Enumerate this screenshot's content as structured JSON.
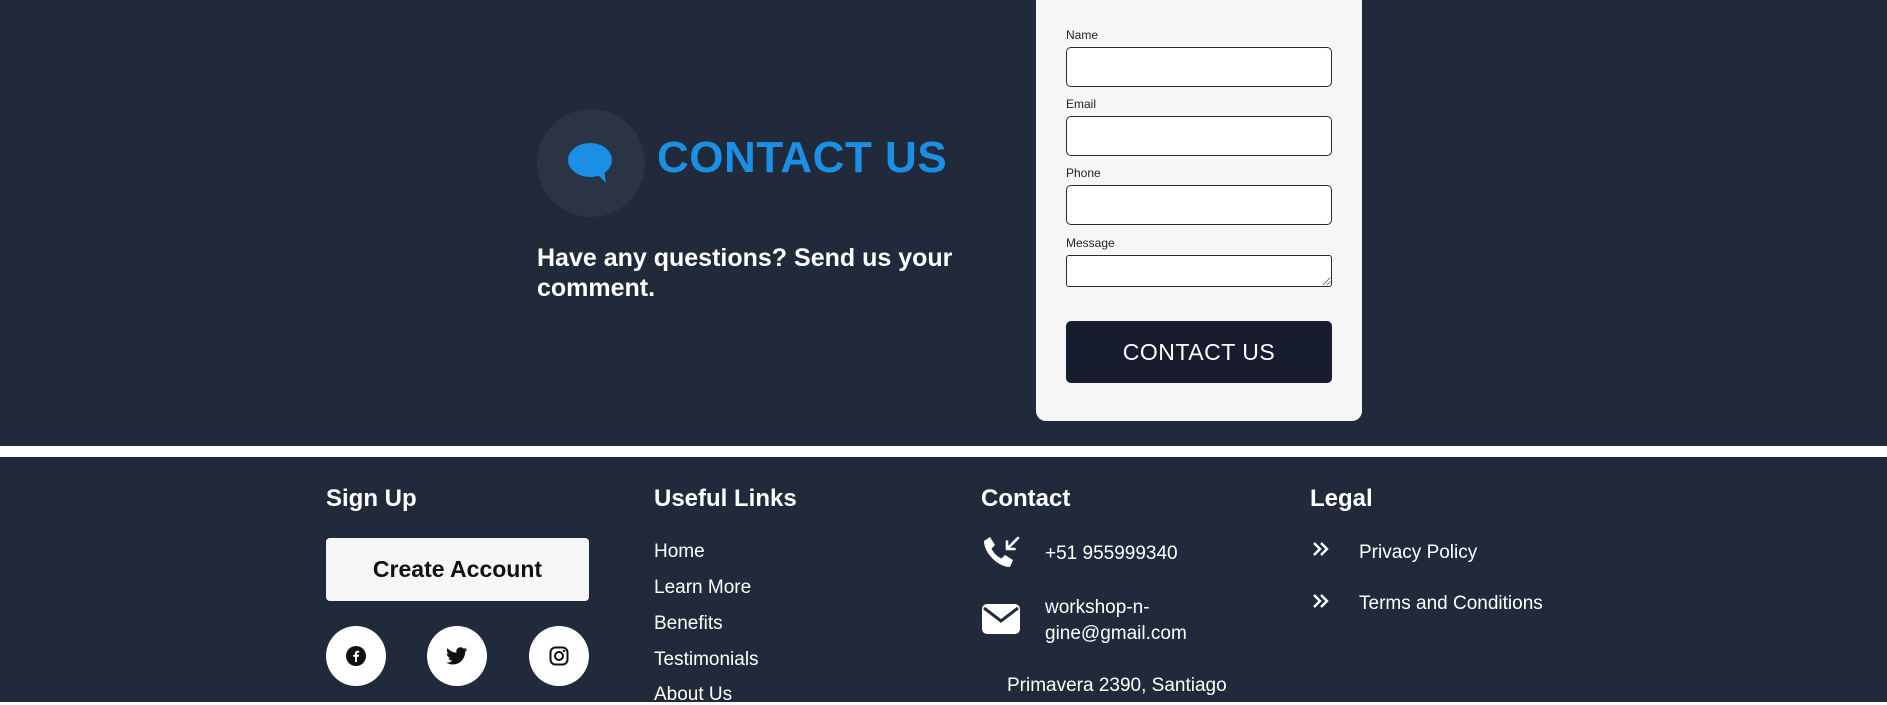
{
  "contact": {
    "title": "CONTACT US",
    "subtitle": "Have any questions? Send us your comment.",
    "accent_color": "#1a8fe3",
    "icon": "chat-bubble-icon"
  },
  "form": {
    "name_label": "Name",
    "name_value": "",
    "email_label": "Email",
    "email_value": "",
    "phone_label": "Phone",
    "phone_value": "",
    "message_label": "Message",
    "message_value": "",
    "submit_label": "CONTACT US"
  },
  "footer": {
    "signup": {
      "heading": "Sign Up",
      "create_account_label": "Create Account",
      "social": [
        {
          "name": "facebook-icon"
        },
        {
          "name": "twitter-icon"
        },
        {
          "name": "instagram-icon"
        }
      ]
    },
    "useful_links": {
      "heading": "Useful Links",
      "items": [
        "Home",
        "Learn More",
        "Benefits",
        "Testimonials",
        "About Us"
      ]
    },
    "contact": {
      "heading": "Contact",
      "phone": "+51 955999340",
      "email_line1": "workshop-n-",
      "email_line2": "gine@gmail.com",
      "address": "Primavera 2390, Santiago"
    },
    "legal": {
      "heading": "Legal",
      "items": [
        "Privacy Policy",
        "Terms and Conditions"
      ]
    }
  }
}
